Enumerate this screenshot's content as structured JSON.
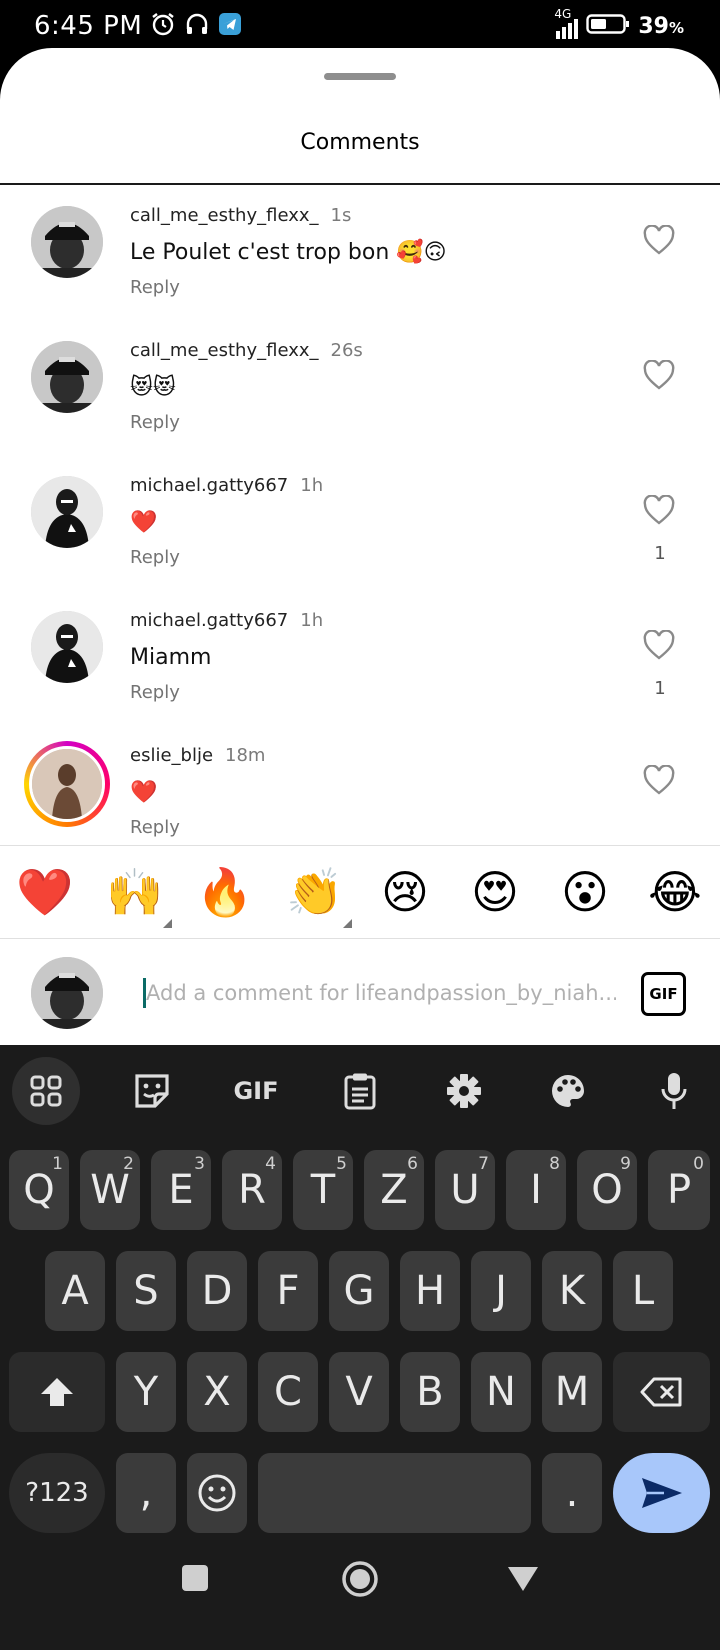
{
  "status_bar": {
    "time": "6:45 PM",
    "network": "4G",
    "battery": "39",
    "battery_unit": "%"
  },
  "sheet": {
    "title": "Comments"
  },
  "comments": [
    {
      "user": "call_me_esthy_flexx_",
      "time": "1s",
      "text": "Le Poulet c'est trop bon 🥰🙃",
      "reply": "Reply",
      "likes": ""
    },
    {
      "user": "call_me_esthy_flexx_",
      "time": "26s",
      "text": "😻😻",
      "reply": "Reply",
      "likes": ""
    },
    {
      "user": "michael.gatty667",
      "time": "1h",
      "text": "❤️",
      "reply": "Reply",
      "likes": "1"
    },
    {
      "user": "michael.gatty667",
      "time": "1h",
      "text": "Miamm",
      "reply": "Reply",
      "likes": "1"
    },
    {
      "user": "eslie_blje",
      "time": "18m",
      "text": "❤️",
      "reply": "Reply",
      "likes": ""
    }
  ],
  "quick_emojis": [
    "❤️",
    "🙌",
    "🔥",
    "👏",
    "😢",
    "😍",
    "😮",
    "😂"
  ],
  "composer": {
    "placeholder": "Add a comment for lifeandpassion_by_niah...",
    "gif_label": "GIF"
  },
  "keyboard": {
    "tools": {
      "gif_label": "GIF"
    },
    "row1": [
      {
        "k": "Q",
        "h": "1"
      },
      {
        "k": "W",
        "h": "2"
      },
      {
        "k": "E",
        "h": "3"
      },
      {
        "k": "R",
        "h": "4"
      },
      {
        "k": "T",
        "h": "5"
      },
      {
        "k": "Z",
        "h": "6"
      },
      {
        "k": "U",
        "h": "7"
      },
      {
        "k": "I",
        "h": "8"
      },
      {
        "k": "O",
        "h": "9"
      },
      {
        "k": "P",
        "h": "0"
      }
    ],
    "row2": [
      "A",
      "S",
      "D",
      "F",
      "G",
      "H",
      "J",
      "K",
      "L"
    ],
    "row3": [
      "Y",
      "X",
      "C",
      "V",
      "B",
      "N",
      "M"
    ],
    "symbols_label": "?123",
    "comma": ",",
    "period": "."
  }
}
